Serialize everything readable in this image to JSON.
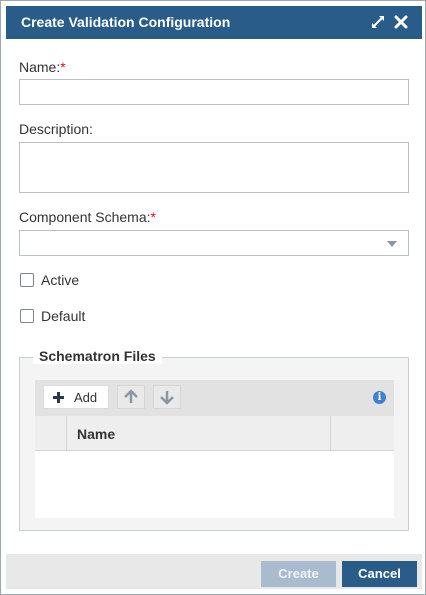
{
  "dialog": {
    "title": "Create Validation Configuration",
    "maximize_icon": "maximize-icon",
    "close_icon": "close-icon"
  },
  "form": {
    "name_label": "Name:",
    "name_required": "*",
    "name_value": "",
    "description_label": "Description:",
    "description_value": "",
    "schema_label": "Component Schema:",
    "schema_required": "*",
    "schema_value": "",
    "active_label": "Active",
    "active_checked": false,
    "default_label": "Default",
    "default_checked": false
  },
  "schematron": {
    "legend": "Schematron Files",
    "add_label": "Add",
    "add_icon": "plus-icon",
    "move_up_icon": "arrow-up-icon",
    "move_down_icon": "arrow-down-icon",
    "info_icon": "info-icon",
    "info_glyph": "i",
    "columns": [
      "",
      "Name",
      ""
    ],
    "rows": []
  },
  "footer": {
    "create_label": "Create",
    "cancel_label": "Cancel"
  },
  "colors": {
    "header": "#2a5c8a",
    "required": "#d0161b",
    "create_disabled": "#a9bccf",
    "cancel": "#2a5c8a"
  }
}
